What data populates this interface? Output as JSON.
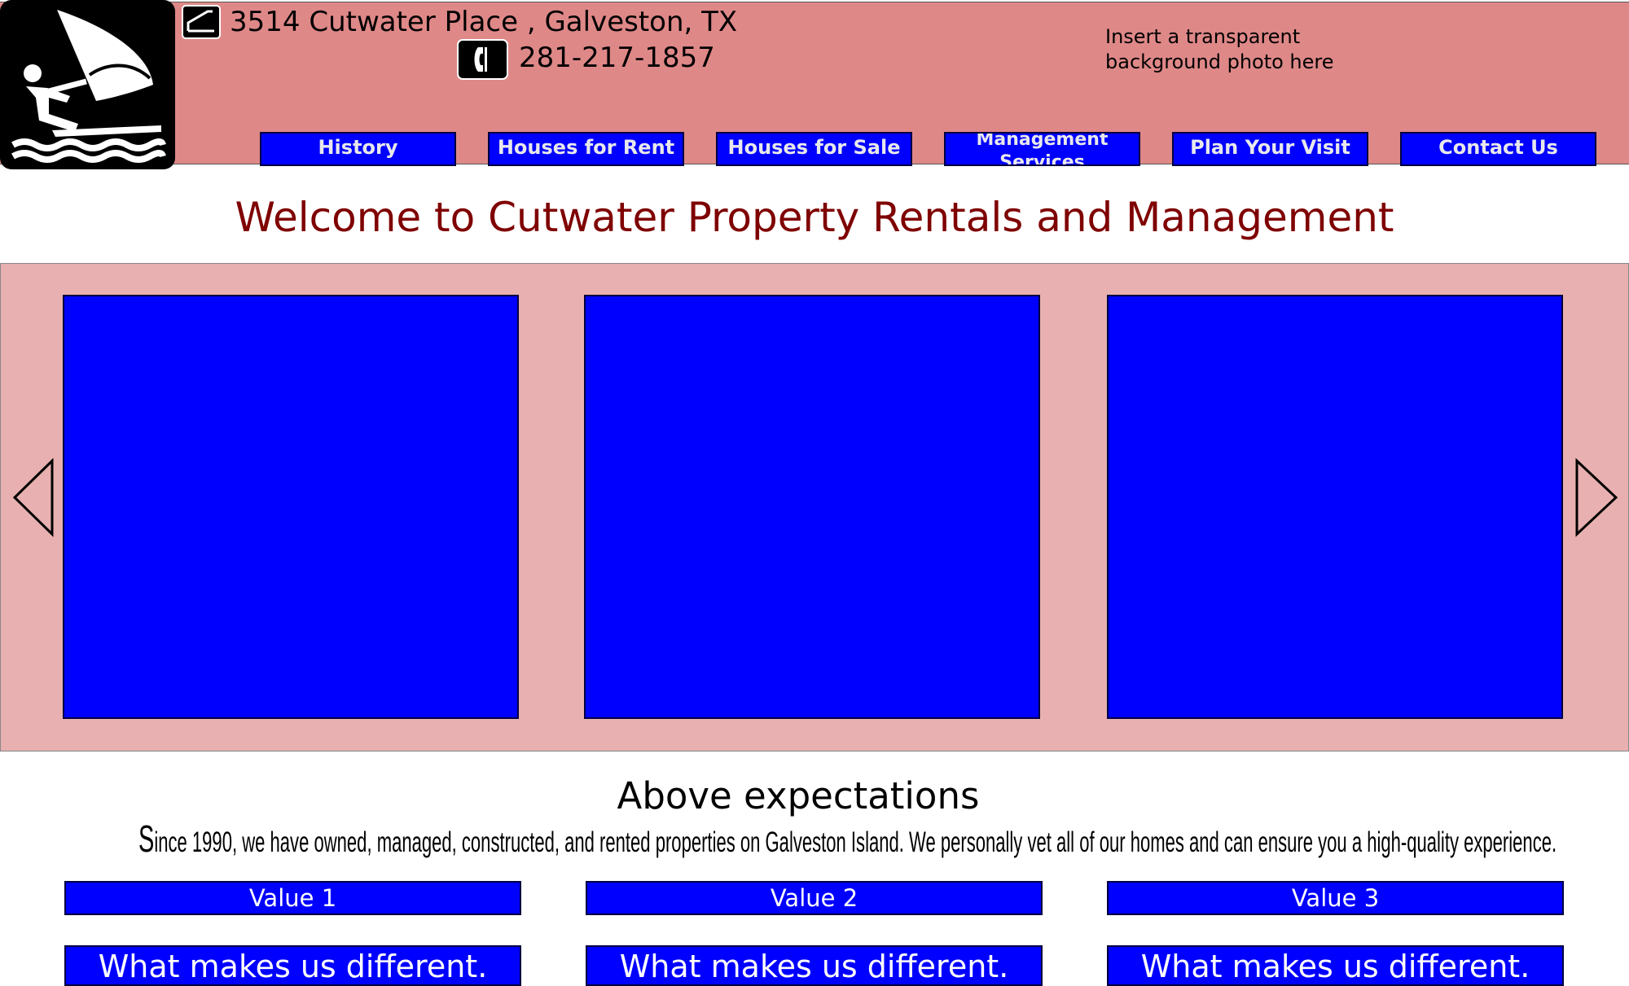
{
  "header": {
    "address": "3514 Cutwater Place , Galveston, TX",
    "phone": "281-217-1857",
    "background_note": "Insert a transparent background photo here",
    "logo_icon": "windsurfing-icon",
    "address_icon": "house-icon",
    "phone_icon": "phone-icon"
  },
  "nav": {
    "history": "History",
    "houses_for_rent": "Houses for Rent",
    "houses_for_sale": "Houses for Sale",
    "management_services": "Management Services",
    "plan_your_visit": "Plan Your Visit",
    "contact_us": "Contact Us"
  },
  "welcome": {
    "title": "Welcome to Cutwater Property Rentals and Management"
  },
  "carousel": {
    "prev_icon": "chevron-left-icon",
    "next_icon": "chevron-right-icon"
  },
  "about": {
    "title": "Above expectations",
    "description": "Since 1990, we have owned, managed, constructed, and rented properties on Galveston Island. We personally vet all of our homes and can ensure you a high-quality experience."
  },
  "values": [
    {
      "label": "Value 1",
      "detail": "What makes us different."
    },
    {
      "label": "Value 2",
      "detail": "What makes us different."
    },
    {
      "label": "Value 3",
      "detail": "What makes us different."
    }
  ],
  "colors": {
    "header_bg": "#df8888",
    "carousel_bg": "#e8b0b0",
    "accent_blue": "#0000ff",
    "title_red": "#7f0000"
  }
}
